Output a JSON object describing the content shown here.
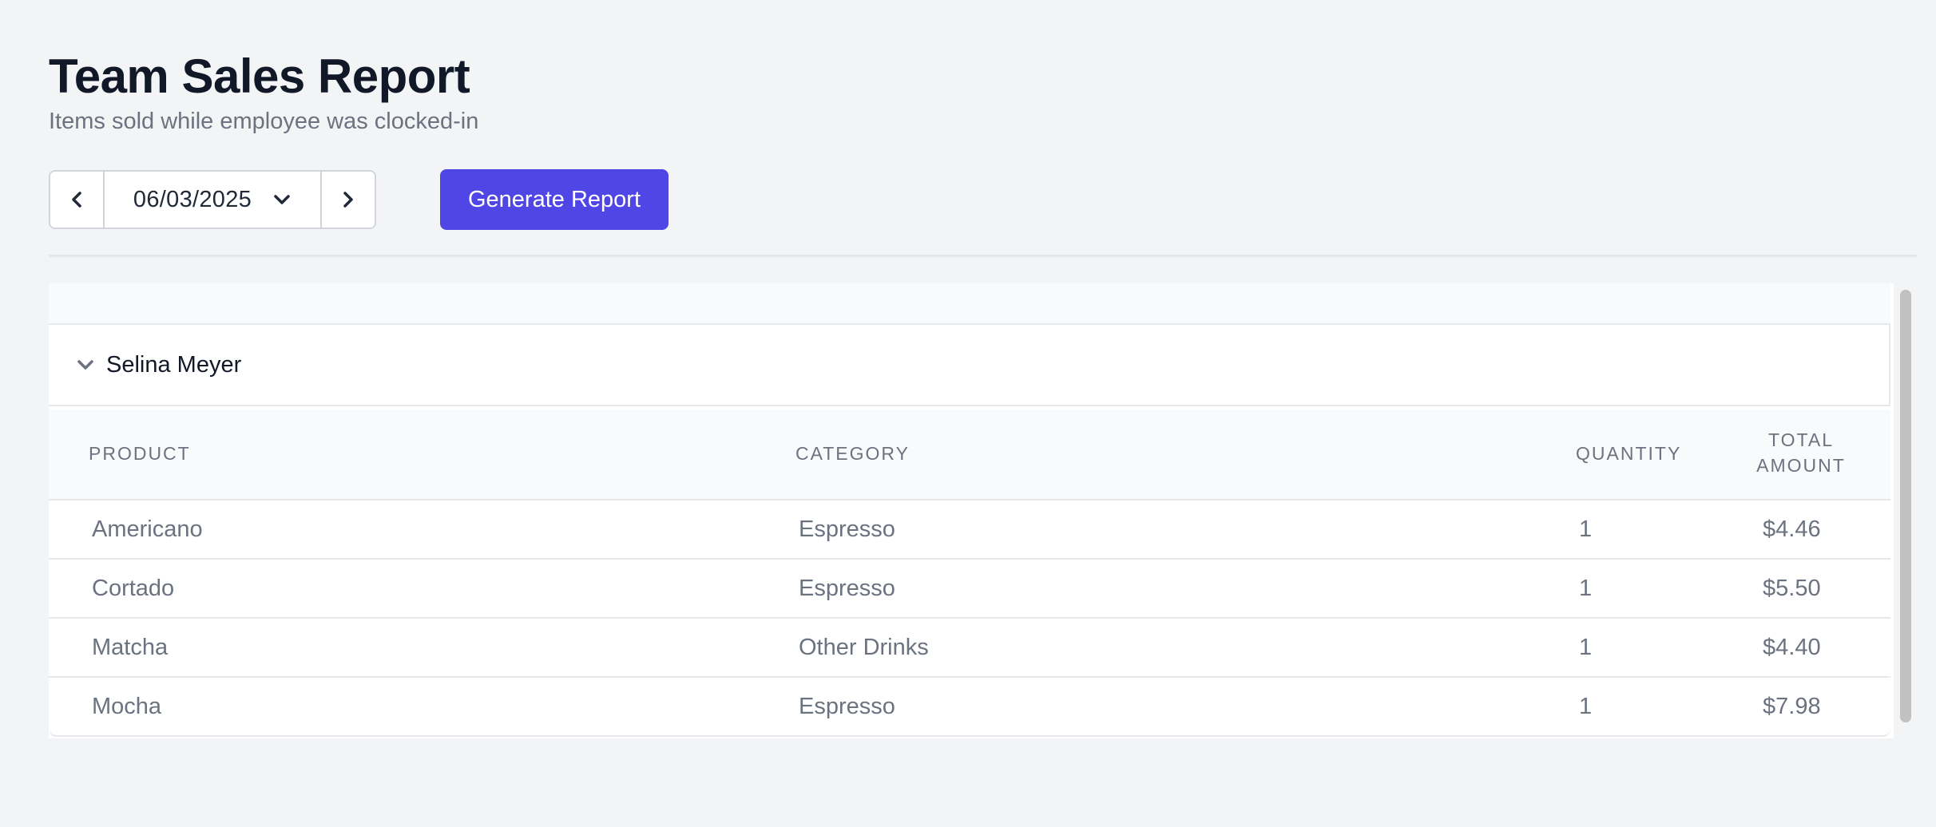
{
  "header": {
    "title": "Team Sales Report",
    "subtitle": "Items sold while employee was clocked-in"
  },
  "controls": {
    "prev_icon": "chevron-left-icon",
    "date_value": "06/03/2025",
    "date_dropdown_icon": "chevron-down-icon",
    "next_icon": "chevron-right-icon",
    "generate_label": "Generate Report",
    "accent_color": "#4f46e5"
  },
  "report": {
    "employee": {
      "name": "Selina Meyer",
      "expand_icon": "chevron-down-icon"
    },
    "columns": {
      "product": "PRODUCT",
      "category": "CATEGORY",
      "quantity": "QUANTITY",
      "total_line1": "TOTAL",
      "total_line2": "AMOUNT"
    },
    "rows": [
      {
        "product": "Americano",
        "category": "Espresso",
        "quantity": "1",
        "total": "$4.46"
      },
      {
        "product": "Cortado",
        "category": "Espresso",
        "quantity": "1",
        "total": "$5.50"
      },
      {
        "product": "Matcha",
        "category": "Other Drinks",
        "quantity": "1",
        "total": "$4.40"
      },
      {
        "product": "Mocha",
        "category": "Espresso",
        "quantity": "1",
        "total": "$7.98"
      }
    ]
  }
}
